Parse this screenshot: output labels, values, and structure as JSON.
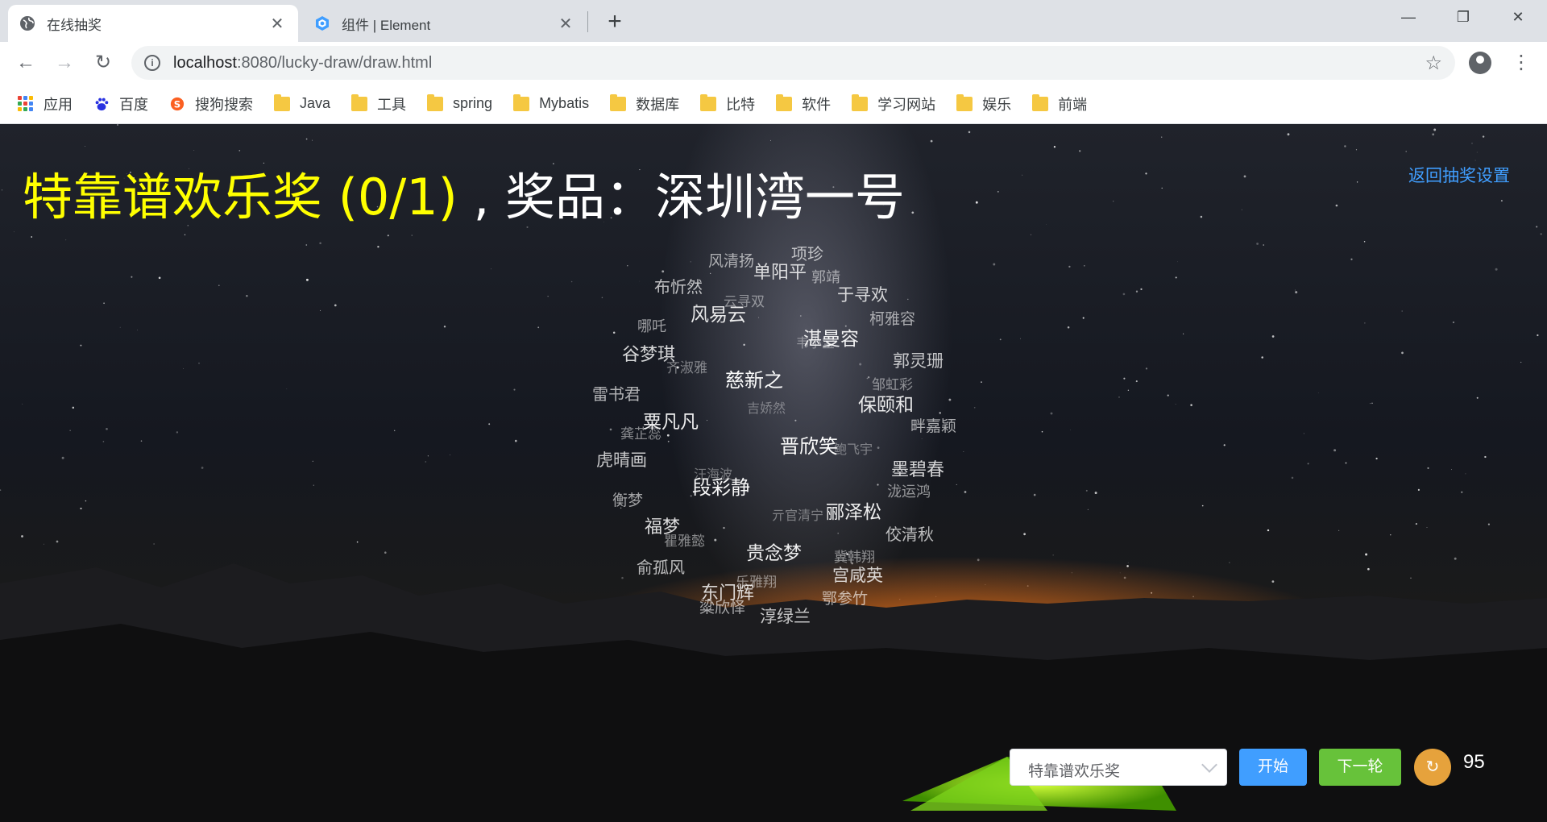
{
  "browser": {
    "tabs": [
      {
        "title": "在线抽奖",
        "icon": "globe-icon",
        "active": true
      },
      {
        "title": "组件 | Element",
        "icon": "element-logo-icon",
        "active": false
      }
    ],
    "close_glyph": "✕",
    "new_tab_glyph": "+",
    "window_controls": {
      "minimize": "—",
      "maximize": "❐",
      "close": "✕"
    },
    "nav": {
      "back": "←",
      "forward": "→",
      "reload": "↻"
    },
    "url_host": "localhost",
    "url_path": ":8080/lucky-draw/draw.html",
    "star_glyph": "☆",
    "menu_glyph": "⋮",
    "bookmarks": [
      {
        "label": "应用",
        "icon": "apps-grid-icon"
      },
      {
        "label": "百度",
        "icon": "baidu-paw-icon"
      },
      {
        "label": "搜狗搜索",
        "icon": "sogou-icon"
      },
      {
        "label": "Java",
        "icon": "folder-icon"
      },
      {
        "label": "工具",
        "icon": "folder-icon"
      },
      {
        "label": "spring",
        "icon": "folder-icon"
      },
      {
        "label": "Mybatis",
        "icon": "folder-icon"
      },
      {
        "label": "数据库",
        "icon": "folder-icon"
      },
      {
        "label": "比特",
        "icon": "folder-icon"
      },
      {
        "label": "软件",
        "icon": "folder-icon"
      },
      {
        "label": "学习网站",
        "icon": "folder-icon"
      },
      {
        "label": "娱乐",
        "icon": "folder-icon"
      },
      {
        "label": "前端",
        "icon": "folder-icon"
      }
    ]
  },
  "page": {
    "award_text": "特靠谱欢乐奖 (0/1)",
    "prize_text": " , 奖品：深圳湾一号",
    "back_link": "返回抽奖设置",
    "colors": {
      "award": "#ffff00",
      "link": "#409eff",
      "start": "#409eff",
      "next": "#67c23a",
      "refresh": "#e6a23c"
    },
    "controls": {
      "award_select_value": "特靠谱欢乐奖",
      "start_label": "开始",
      "next_label": "下一轮",
      "refresh_glyph": "↻",
      "remaining_count": "95"
    },
    "name_cloud": [
      "项珍",
      "风清扬",
      "单阳平",
      "郭靖",
      "布忻然",
      "于寻欢",
      "云寻双",
      "风易云",
      "柯雅容",
      "哪吒",
      "湛曼容",
      "韦小宝",
      "谷梦琪",
      "郭灵珊",
      "齐淑雅",
      "慈新之",
      "邹虹彩",
      "雷书君",
      "保颐和",
      "吉娇然",
      "粟凡凡",
      "畔嘉颖",
      "龚芷蕊",
      "晋欣笑",
      "鲍飞宇",
      "虎晴画",
      "墨碧春",
      "汪海波",
      "段彩静",
      "泷运鸿",
      "衡梦",
      "郦泽松",
      "亓官清宁",
      "福梦",
      "佼清秋",
      "瞿雅懿",
      "贵念梦",
      "冀韩翔",
      "俞孤风",
      "宫咸英",
      "乐雅翔",
      "东门辉",
      "鄂参竹",
      "粱欣怿",
      "淳绿兰"
    ]
  }
}
